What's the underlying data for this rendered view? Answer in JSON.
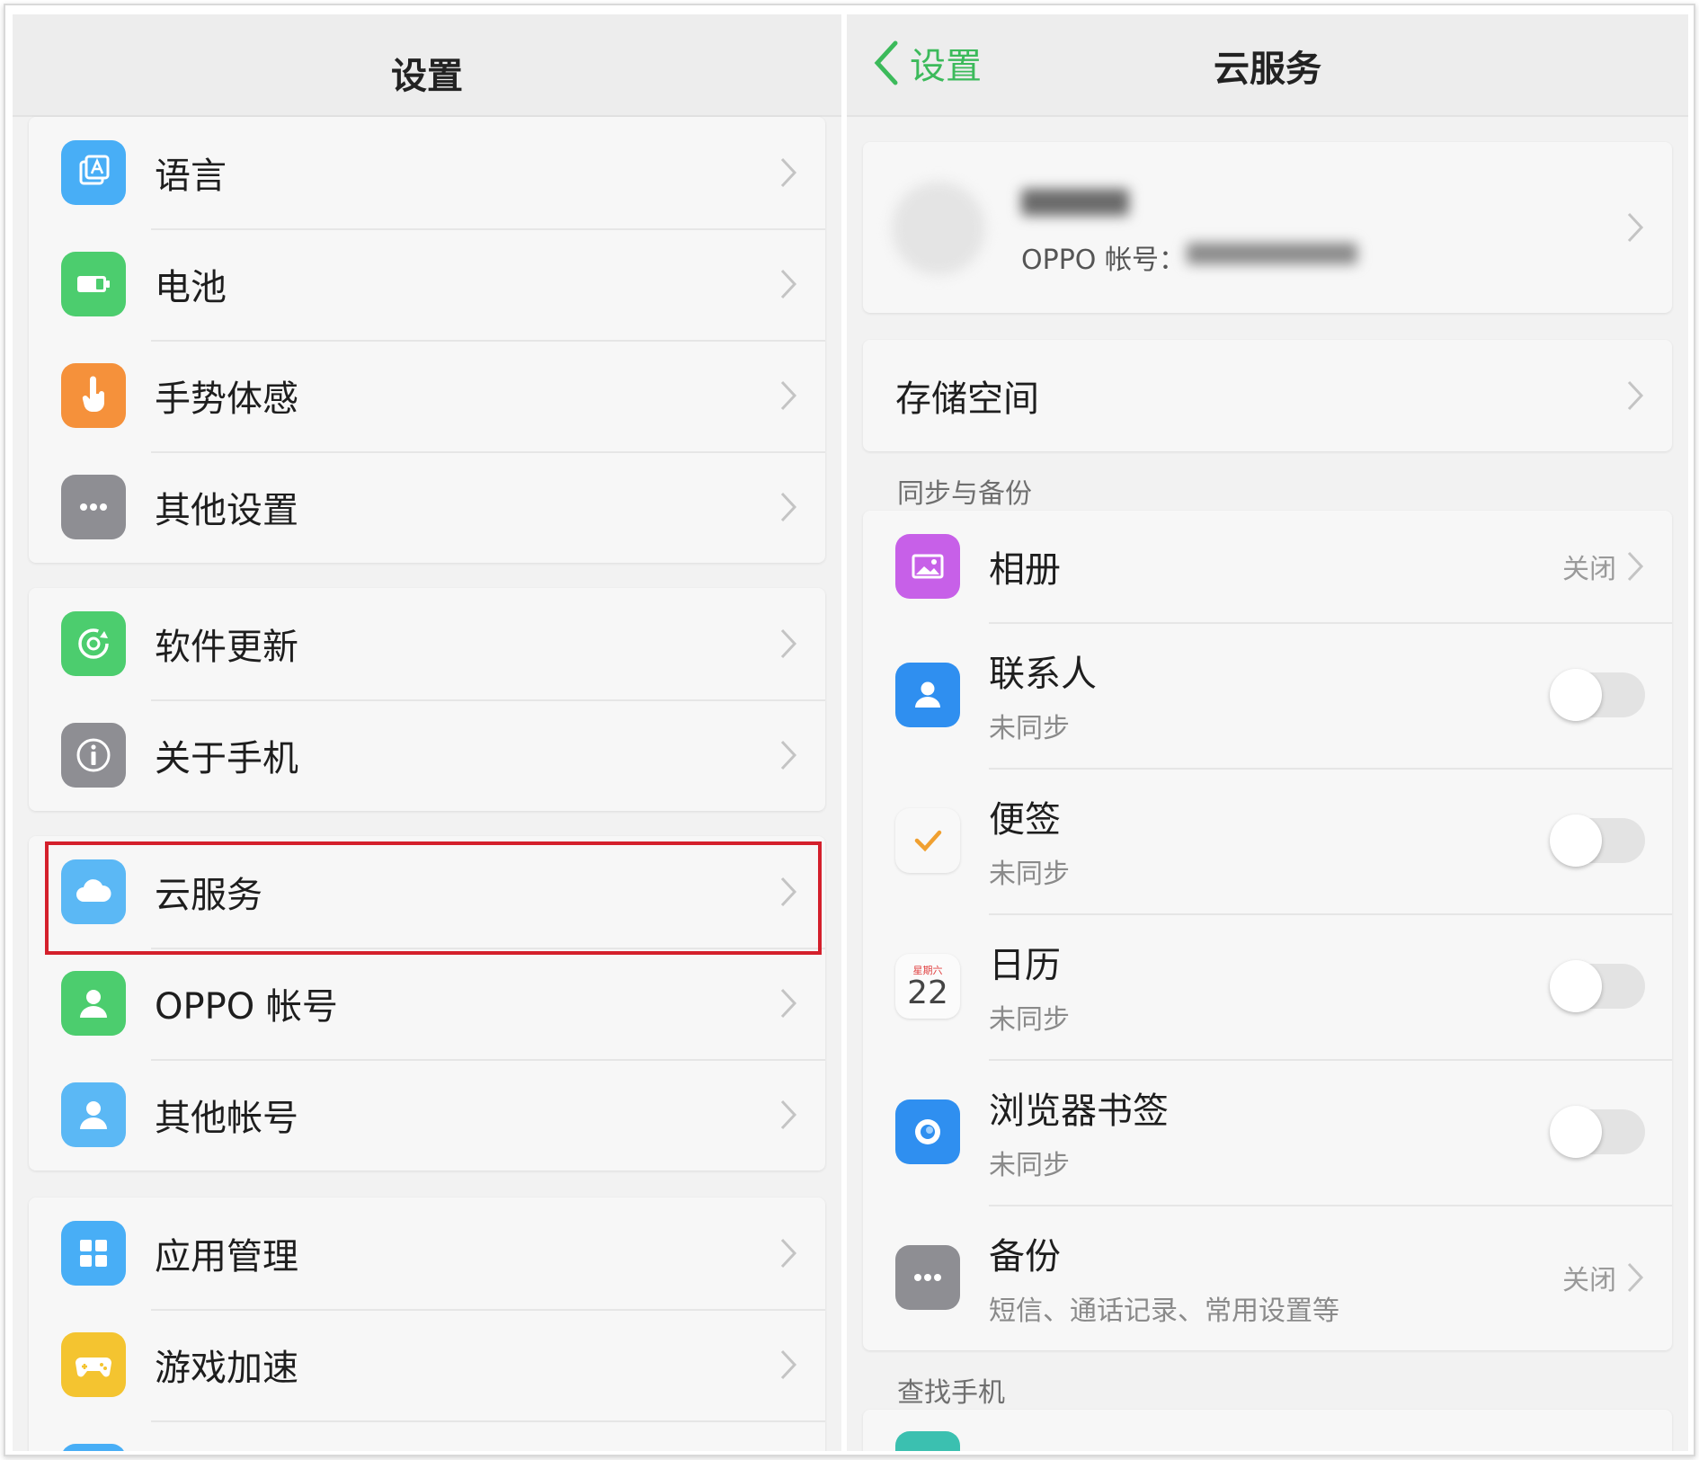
{
  "left": {
    "nav_title": "设置",
    "groups": [
      {
        "items": [
          {
            "label": "语言",
            "icon": "language-icon",
            "color": "#48aef6"
          },
          {
            "label": "电池",
            "icon": "battery-icon",
            "color": "#4ccd6e"
          },
          {
            "label": "手势体感",
            "icon": "gesture-icon",
            "color": "#f5913b"
          },
          {
            "label": "其他设置",
            "icon": "more-icon",
            "color": "#8e8e93"
          }
        ]
      },
      {
        "items": [
          {
            "label": "软件更新",
            "icon": "update-icon",
            "color": "#4ccd6e"
          },
          {
            "label": "关于手机",
            "icon": "info-icon",
            "color": "#8e8e93"
          }
        ]
      },
      {
        "items": [
          {
            "label": "云服务",
            "icon": "cloud-icon",
            "color": "#5bb8f5"
          },
          {
            "label": "OPPO 帐号",
            "icon": "user-icon",
            "color": "#4ccd6e"
          },
          {
            "label": "其他帐号",
            "icon": "contacts-user-icon",
            "color": "#5bb8f5"
          }
        ]
      },
      {
        "items": [
          {
            "label": "应用管理",
            "icon": "app-grid-icon",
            "color": "#48aef6"
          },
          {
            "label": "游戏加速",
            "icon": "gamepad-icon",
            "color": "#f4c430"
          }
        ]
      }
    ]
  },
  "right": {
    "nav_title": "云服务",
    "back_label": "设置",
    "account": {
      "label": "OPPO 帐号："
    },
    "storage_label": "存储空间",
    "section_sync": "同步与备份",
    "sync_items": [
      {
        "title": "相册",
        "subtitle": "",
        "status": "关闭",
        "control": "chevron",
        "icon": "photo-album-icon"
      },
      {
        "title": "联系人",
        "subtitle": "未同步",
        "control": "toggle",
        "icon": "contacts-icon"
      },
      {
        "title": "便签",
        "subtitle": "未同步",
        "control": "toggle",
        "icon": "notes-check-icon"
      },
      {
        "title": "日历",
        "subtitle": "未同步",
        "control": "toggle",
        "icon": "calendar-icon"
      },
      {
        "title": "浏览器书签",
        "subtitle": "未同步",
        "control": "toggle",
        "icon": "browser-icon"
      },
      {
        "title": "备份",
        "subtitle": "短信、通话记录、常用设置等",
        "status": "关闭",
        "control": "chevron",
        "icon": "more-icon"
      }
    ],
    "calendar_icon": {
      "weekday": "星期六",
      "day": "22"
    },
    "section_find": "查找手机"
  },
  "colors": {
    "accent_green": "#3cba5b",
    "highlight_red": "#d4202c"
  }
}
